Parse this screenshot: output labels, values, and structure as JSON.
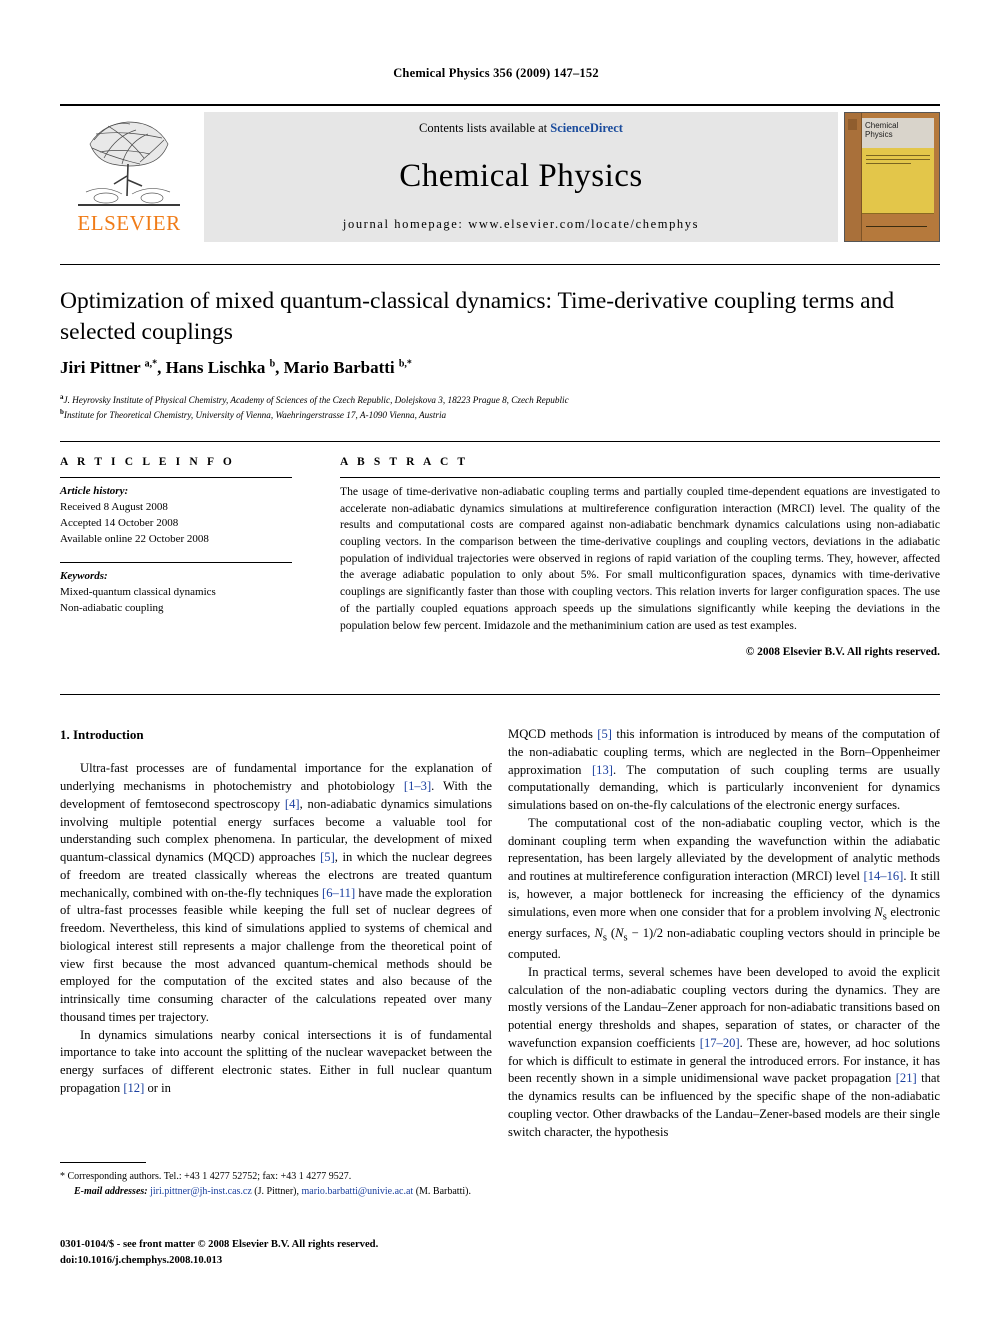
{
  "running_head": "Chemical Physics 356 (2009) 147–152",
  "masthead": {
    "publisher_name": "ELSEVIER",
    "contents_prefix": "Contents lists available at",
    "contents_link": "ScienceDirect",
    "journal_title": "Chemical Physics",
    "homepage": "journal homepage: www.elsevier.com/locate/chemphys",
    "cover_title_line1": "Chemical",
    "cover_title_line2": "Physics"
  },
  "article": {
    "title": "Optimization of mixed quantum-classical dynamics: Time-derivative coupling terms and selected couplings",
    "authors_html": "Jiri Pittner <sup>a,*</sup>, Hans Lischka <sup>b</sup>, Mario Barbatti <sup>b,*</sup>",
    "affiliation_a": "J. Heyrovsky Institute of Physical Chemistry, Academy of Sciences of the Czech Republic, Dolejskova 3, 18223 Prague 8, Czech Republic",
    "affiliation_b": "Institute for Theoretical Chemistry, University of Vienna, Waehringerstrasse 17, A-1090 Vienna, Austria"
  },
  "info": {
    "heading": "A R T I C L E    I N F O",
    "history_label": "Article history:",
    "history": [
      "Received 8 August 2008",
      "Accepted 14 October 2008",
      "Available online 22 October 2008"
    ],
    "keywords_label": "Keywords:",
    "keywords": [
      "Mixed-quantum classical dynamics",
      "Non-adiabatic coupling"
    ]
  },
  "abstract": {
    "heading": "A B S T R A C T",
    "text": "The usage of time-derivative non-adiabatic coupling terms and partially coupled time-dependent equations are investigated to accelerate non-adiabatic dynamics simulations at multireference configuration interaction (MRCI) level. The quality of the results and computational costs are compared against non-adiabatic benchmark dynamics calculations using non-adiabatic coupling vectors. In the comparison between the time-derivative couplings and coupling vectors, deviations in the adiabatic population of individual trajectories were observed in regions of rapid variation of the coupling terms. They, however, affected the average adiabatic population to only about 5%. For small multiconfiguration spaces, dynamics with time-derivative couplings are significantly faster than those with coupling vectors. This relation inverts for larger configuration spaces. The use of the partially coupled equations approach speeds up the simulations significantly while keeping the deviations in the population below few percent. Imidazole and the methaniminium cation are used as test examples.",
    "copyright": "© 2008 Elsevier B.V. All rights reserved."
  },
  "body": {
    "section1_heading": "1. Introduction",
    "left_p1": "Ultra-fast processes are of fundamental importance for the explanation of underlying mechanisms in photochemistry and photobiology [1–3]. With the development of femtosecond spectroscopy [4], non-adiabatic dynamics simulations involving multiple potential energy surfaces become a valuable tool for understanding such complex phenomena. In particular, the development of mixed quantum-classical dynamics (MQCD) approaches [5], in which the nuclear degrees of freedom are treated classically whereas the electrons are treated quantum mechanically, combined with on-the-fly techniques [6–11] have made the exploration of ultra-fast processes feasible while keeping the full set of nuclear degrees of freedom. Nevertheless, this kind of simulations applied to systems of chemical and biological interest still represents a major challenge from the theoretical point of view first because the most advanced quantum-chemical methods should be employed for the computation of the excited states and also because of the intrinsically time consuming character of the calculations repeated over many thousand times per trajectory.",
    "left_p2": "In dynamics simulations nearby conical intersections it is of fundamental importance to take into account the splitting of the nuclear wavepacket between the energy surfaces of different electronic states. Either in full nuclear quantum propagation [12] or in",
    "right_p1": "MQCD methods [5] this information is introduced by means of the computation of the non-adiabatic coupling terms, which are neglected in the Born–Oppenheimer approximation [13]. The computation of such coupling terms are usually computationally demanding, which is particularly inconvenient for dynamics simulations based on on-the-fly calculations of the electronic energy surfaces.",
    "right_p2": "The computational cost of the non-adiabatic coupling vector, which is the dominant coupling term when expanding the wavefunction within the adiabatic representation, has been largely alleviated by the development of analytic methods and routines at multireference configuration interaction (MRCI) level [14–16]. It still is, however, a major bottleneck for increasing the efficiency of the dynamics simulations, even more when one consider that for a problem involving Ns electronic energy surfaces, Ns (Ns − 1)/2 non-adiabatic coupling vectors should in principle be computed.",
    "right_p3": "In practical terms, several schemes have been developed to avoid the explicit calculation of the non-adiabatic coupling vectors during the dynamics. They are mostly versions of the Landau–Zener approach for non-adiabatic transitions based on potential energy thresholds and shapes, separation of states, or character of the wavefunction expansion coefficients [17–20]. These are, however, ad hoc solutions for which is difficult to estimate in general the introduced errors. For instance, it has been recently shown in a simple unidimensional wave packet propagation [21] that the dynamics results can be influenced by the specific shape of the non-adiabatic coupling vector. Other drawbacks of the Landau–Zener-based models are their single switch character, the hypothesis"
  },
  "footnote": {
    "corresponding": "Corresponding authors. Tel.: +43 1 4277 52752; fax: +43 1 4277 9527.",
    "email_label": "E-mail addresses:",
    "email1": "jiri.pittner@jh-inst.cas.cz",
    "email1_name": "(J. Pittner),",
    "email2": "mario.barbatti@univie.ac.at",
    "email2_name": "(M. Barbatti)."
  },
  "imprint": {
    "line1": "0301-0104/$ - see front matter © 2008 Elsevier B.V. All rights reserved.",
    "line2": "doi:10.1016/j.chemphys.2008.10.013"
  },
  "colors": {
    "link_blue": "#1a4b9c",
    "ref_blue": "#1a3f9e",
    "elsevier_orange": "#f07c18",
    "band_gray": "#e6e6e6"
  }
}
